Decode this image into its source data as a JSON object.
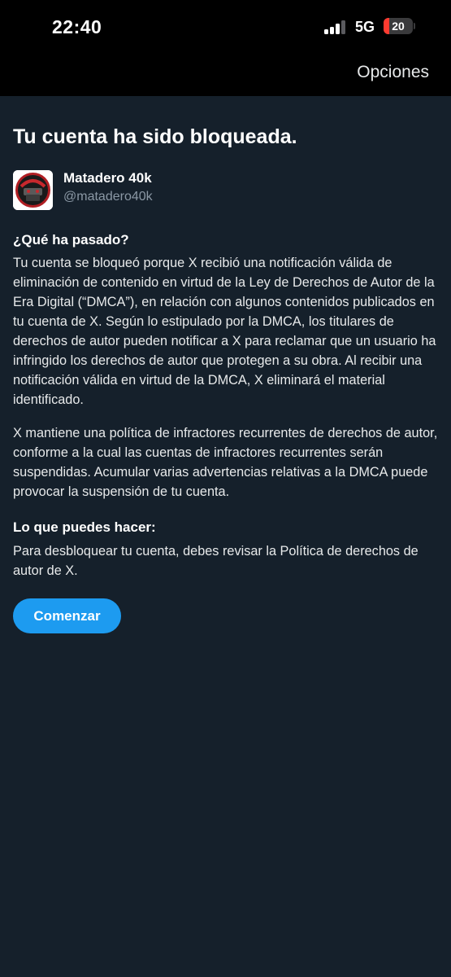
{
  "status_bar": {
    "time": "22:40",
    "network": "5G",
    "battery_level": "20",
    "battery_fraction": 0.2,
    "signal_bars_active": 3,
    "signal_bars_total": 4,
    "battery_color": "#ff3b30"
  },
  "nav": {
    "options_label": "Opciones"
  },
  "page": {
    "title": "Tu cuenta ha sido bloqueada."
  },
  "account": {
    "name": "Matadero 40k",
    "handle": "@matadero40k"
  },
  "what_happened": {
    "heading": "¿Qué ha pasado?",
    "paragraph_1": "Tu cuenta se bloqueó porque X recibió una notificación válida de eliminación de contenido en virtud de la Ley de Derechos de Autor de la Era Digital (“DMCA”), en relación con algunos contenidos publicados en tu cuenta de X. Según lo estipulado por la DMCA, los titulares de derechos de autor pueden notificar a X para reclamar que un usuario ha infringido los derechos de autor que protegen a su obra. Al recibir una notificación válida en virtud de la DMCA, X eliminará el material identificado.",
    "paragraph_2": "X mantiene una política de infractores recurrentes de derechos de autor, conforme a la cual las cuentas de infractores recurrentes serán suspendidas. Acumular varias advertencias relativas a la DMCA puede provocar la suspensión de tu cuenta."
  },
  "what_you_can_do": {
    "heading": "Lo que puedes hacer:",
    "paragraph": "Para desbloquear tu cuenta, debes revisar la Política de derechos de autor de X."
  },
  "cta": {
    "label": "Comenzar",
    "color": "#1d9bf0"
  },
  "theme": {
    "background": "#15202b",
    "bars": "#000000"
  }
}
